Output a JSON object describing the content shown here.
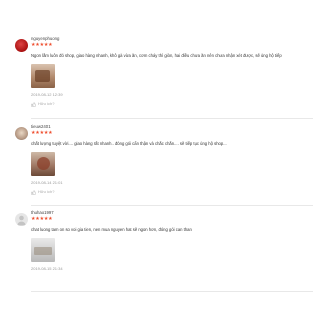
{
  "reviews": [
    {
      "username": "nguyenphuong",
      "stars": "★★★★★",
      "comment": "Ngon lắm luôn đó shop, giao hàng nhanh, khô gà vừa ăn, cơm cháy thì giòn, hai điều chưa ăn nên chưa nhận xét được, sẽ ủng hộ tiếp",
      "timestamp": "2019-08-12 12:39",
      "helpful_label": "Hữu ích?"
    },
    {
      "username": "tieuw2401",
      "stars": "★★★★★",
      "comment": "chất lượng tuyệt vời.... giao hàng rất nhanh.. đóng gói cẩn thận và chắc chắn.... sẽ tiếp tục ủng hộ shop...",
      "timestamp": "2019-08-14 21:01",
      "helpful_label": "Hữu ích?"
    },
    {
      "username": "thuhao1997",
      "stars": "★★★★★",
      "comment": "chat luong tam on so voi gia tien, nen mua nguyen hat sẽ ngon hơn, đóng gói can than",
      "timestamp": "2019-08-15 21:34"
    }
  ]
}
